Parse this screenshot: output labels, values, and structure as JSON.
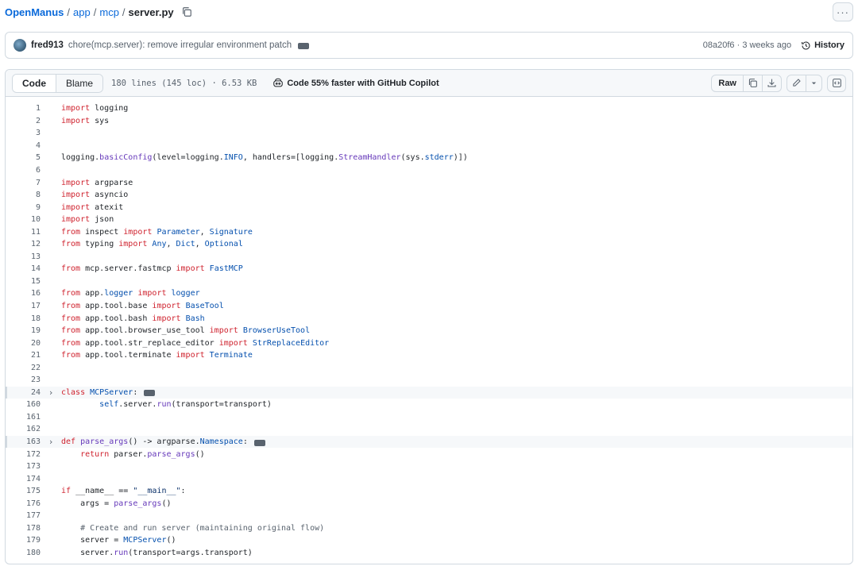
{
  "breadcrumb": {
    "repo": "OpenManus",
    "sep": "/",
    "path1": "app",
    "path2": "mcp",
    "file": "server.py"
  },
  "commit": {
    "user": "fred913",
    "message": "chore(mcp.server): remove irregular environment patch",
    "hash_time": "08a20f6 · 3 weeks ago",
    "history_label": "History"
  },
  "toolbar": {
    "code_tab": "Code",
    "blame_tab": "Blame",
    "meta": "180 lines (145 loc) · 6.53 KB",
    "copilot": "Code 55% faster with GitHub Copilot",
    "raw_label": "Raw"
  },
  "code_lines": [
    {
      "n": "1",
      "t": "import logging"
    },
    {
      "n": "2",
      "t": "import sys"
    },
    {
      "n": "3",
      "t": ""
    },
    {
      "n": "4",
      "t": ""
    },
    {
      "n": "5",
      "t": "logging.basicConfig(level=logging.INFO, handlers=[logging.StreamHandler(sys.stderr)])"
    },
    {
      "n": "6",
      "t": ""
    },
    {
      "n": "7",
      "t": "import argparse"
    },
    {
      "n": "8",
      "t": "import asyncio"
    },
    {
      "n": "9",
      "t": "import atexit"
    },
    {
      "n": "10",
      "t": "import json"
    },
    {
      "n": "11",
      "t": "from inspect import Parameter, Signature"
    },
    {
      "n": "12",
      "t": "from typing import Any, Dict, Optional"
    },
    {
      "n": "13",
      "t": ""
    },
    {
      "n": "14",
      "t": "from mcp.server.fastmcp import FastMCP"
    },
    {
      "n": "15",
      "t": ""
    },
    {
      "n": "16",
      "t": "from app.logger import logger"
    },
    {
      "n": "17",
      "t": "from app.tool.base import BaseTool"
    },
    {
      "n": "18",
      "t": "from app.tool.bash import Bash"
    },
    {
      "n": "19",
      "t": "from app.tool.browser_use_tool import BrowserUseTool"
    },
    {
      "n": "20",
      "t": "from app.tool.str_replace_editor import StrReplaceEditor"
    },
    {
      "n": "21",
      "t": "from app.tool.terminate import Terminate"
    },
    {
      "n": "22",
      "t": ""
    },
    {
      "n": "23",
      "t": ""
    },
    {
      "n": "24",
      "t": "class MCPServer:",
      "fold": true
    },
    {
      "n": "160",
      "t": "        self.server.run(transport=transport)"
    },
    {
      "n": "161",
      "t": ""
    },
    {
      "n": "162",
      "t": ""
    },
    {
      "n": "163",
      "t": "def parse_args() -> argparse.Namespace:",
      "fold": true
    },
    {
      "n": "172",
      "t": "    return parser.parse_args()"
    },
    {
      "n": "173",
      "t": ""
    },
    {
      "n": "174",
      "t": ""
    },
    {
      "n": "175",
      "t": "if __name__ == \"__main__\":"
    },
    {
      "n": "176",
      "t": "    args = parse_args()"
    },
    {
      "n": "177",
      "t": ""
    },
    {
      "n": "178",
      "t": "    # Create and run server (maintaining original flow)"
    },
    {
      "n": "179",
      "t": "    server = MCPServer()"
    },
    {
      "n": "180",
      "t": "    server.run(transport=args.transport)"
    }
  ]
}
